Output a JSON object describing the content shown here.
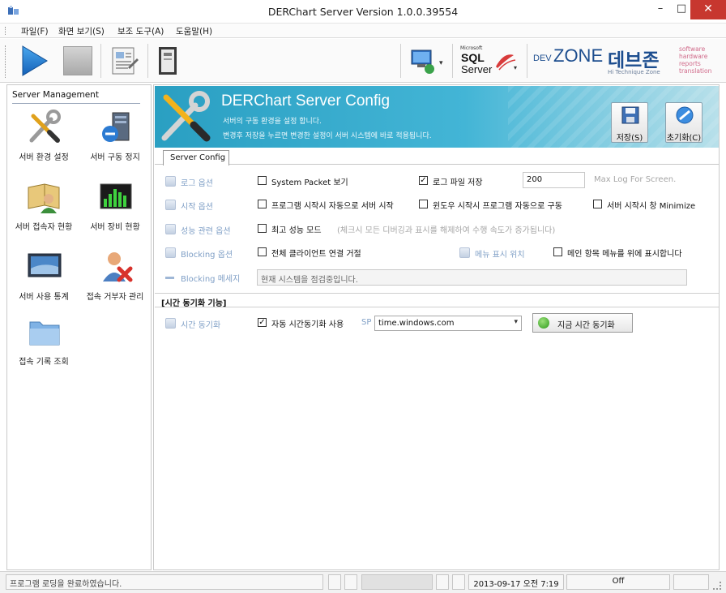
{
  "window": {
    "title": "DERChart Server Version 1.0.0.39554",
    "min_glyph": "–",
    "max_glyph": "□",
    "close_glyph": "✕"
  },
  "menu": {
    "items": [
      "파일(F)",
      "화면 보기(S)",
      "보조 도구(A)",
      "도움말(H)"
    ]
  },
  "toolbar": {
    "play_icon": "play-icon",
    "stop_icon": "stop-icon",
    "report_icon": "report-icon",
    "book_icon": "book-icon",
    "network_icon": "network-computer-icon",
    "sql_brand_small": "Microsoft",
    "sql_brand_line1": "SQL",
    "sql_brand_line2": "Server",
    "devzone_prefix": "DEV",
    "devzone_word": "ZONE",
    "devzone_tagline": "Hi Technique Zone",
    "devzone_korean": "데브존",
    "devzone_side1": "software",
    "devzone_side2": "hardware",
    "devzone_side3": "reports",
    "devzone_side4": "translation"
  },
  "sidebar": {
    "header": "Server Management",
    "items": [
      {
        "label": "서버 환경 설정",
        "icon": "tools-icon"
      },
      {
        "label": "서버 구동 정지",
        "icon": "server-stop-icon"
      },
      {
        "label": "서버 접속자 현황",
        "icon": "user-book-icon"
      },
      {
        "label": "서버 장비 현황",
        "icon": "equalizer-icon"
      },
      {
        "label": "서버 사용 통계",
        "icon": "monitor-icon"
      },
      {
        "label": "접속 거부자 관리",
        "icon": "user-deny-icon"
      },
      {
        "label": "접속 기록 조회",
        "icon": "folder-icon"
      }
    ]
  },
  "banner": {
    "title": "DERChart Server Config",
    "sub1": "서버의 구동 환경을 설정 합니다.",
    "sub2": "변경후 저장을 누르면 변경한 설정이 서버 시스템에 바로 적용됩니다.",
    "save_label": "저장(S)",
    "reset_label": "초기화(C)"
  },
  "tab": {
    "label": "Server Config"
  },
  "config": {
    "log_option": {
      "label": "로그 옵션",
      "system_packet": {
        "label": "System Packet 보기",
        "checked": false
      },
      "log_file_save": {
        "label": "로그 파일 저장",
        "checked": true
      },
      "log_count_value": "200",
      "max_log_hint": "Max Log For Screen."
    },
    "start_option": {
      "label": "시작 옵션",
      "auto_start_server": {
        "label": "프로그램 시작시 자동으로 서버 시작",
        "checked": false
      },
      "windows_autostart": {
        "label": "윈도우 시작시 프로그램 자동으로 구동",
        "checked": false
      },
      "minimize_on_start": {
        "label": "서버 시작시 창 Minimize",
        "checked": false
      }
    },
    "perf_option": {
      "label": "성능 관련 옵션",
      "max_perf_mode": {
        "label": "최고 성능 모드",
        "checked": false
      },
      "hint": "(체크시 모든 디버깅과 표시를 해제하여 수행 속도가 증가됩니다)"
    },
    "blocking_option": {
      "label": "Blocking 옵션",
      "block_all_clients": {
        "label": "전체 클라이언트 연결 거절",
        "checked": false
      },
      "menu_position_label": "메뉴 표시 위치",
      "main_menu_top": {
        "label": "메인 항목 메뉴를 위에 표시합니다",
        "checked": false
      }
    },
    "blocking_message": {
      "label": "Blocking 메세지",
      "value": "현재 시스템을 점검중입니다."
    }
  },
  "time_sync": {
    "section_header": "[시간 동기화 기능]",
    "label": "시간 동기화",
    "auto_sync": {
      "label": "자동 시간동기화 사용",
      "checked": true
    },
    "server_prefix": "SP",
    "server_value": "time.windows.com",
    "sync_now_label": "지금 시간 동기화"
  },
  "statusbar": {
    "message": "프로그램 로딩을 완료하였습니다.",
    "datetime": "2013-09-17 오전 7:19",
    "state": "Off"
  },
  "colors": {
    "banner_start": "#2a9fc2",
    "label_blue": "#7f9fc6",
    "close_red": "#c7372f"
  }
}
